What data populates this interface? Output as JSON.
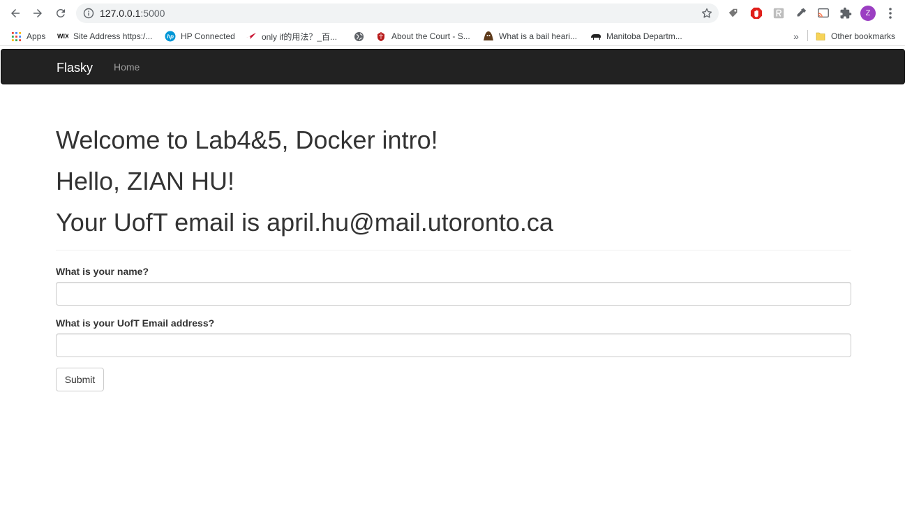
{
  "browser": {
    "url_host": "127.0.0.1",
    "url_port": ":5000",
    "profile_initial": "Z",
    "bookmarks": [
      {
        "label": "Apps",
        "icon": "apps-grid-icon"
      },
      {
        "label": "Site Address https:/...",
        "icon": "wix-icon"
      },
      {
        "label": "HP Connected",
        "icon": "hp-icon"
      },
      {
        "label": "only if的用法？_百...",
        "icon": "airline-icon"
      },
      {
        "label": "",
        "icon": "globe-icon"
      },
      {
        "label": "About the Court - S...",
        "icon": "court-crest-icon"
      },
      {
        "label": "What is a bail heari...",
        "icon": "bail-site-icon"
      },
      {
        "label": "Manitoba Departm...",
        "icon": "bison-icon"
      }
    ],
    "overflow_label": "»",
    "other_bookmarks": "Other bookmarks"
  },
  "app": {
    "brand": "Flasky",
    "nav_home": "Home"
  },
  "main": {
    "welcome": "Welcome to Lab4&5, Docker intro!",
    "hello": "Hello, ZIAN HU!",
    "email_line": "Your UofT email is april.hu@mail.utoronto.ca"
  },
  "form": {
    "name_label": "What is your name?",
    "name_value": "",
    "email_label": "What is your UofT Email address?",
    "email_value": "",
    "submit_label": "Submit"
  },
  "colors": {
    "navbar_bg": "#222222",
    "brand_text": "#ffffff",
    "nav_link": "#9d9d9d",
    "profile_avatar": "#9b3fc2"
  }
}
